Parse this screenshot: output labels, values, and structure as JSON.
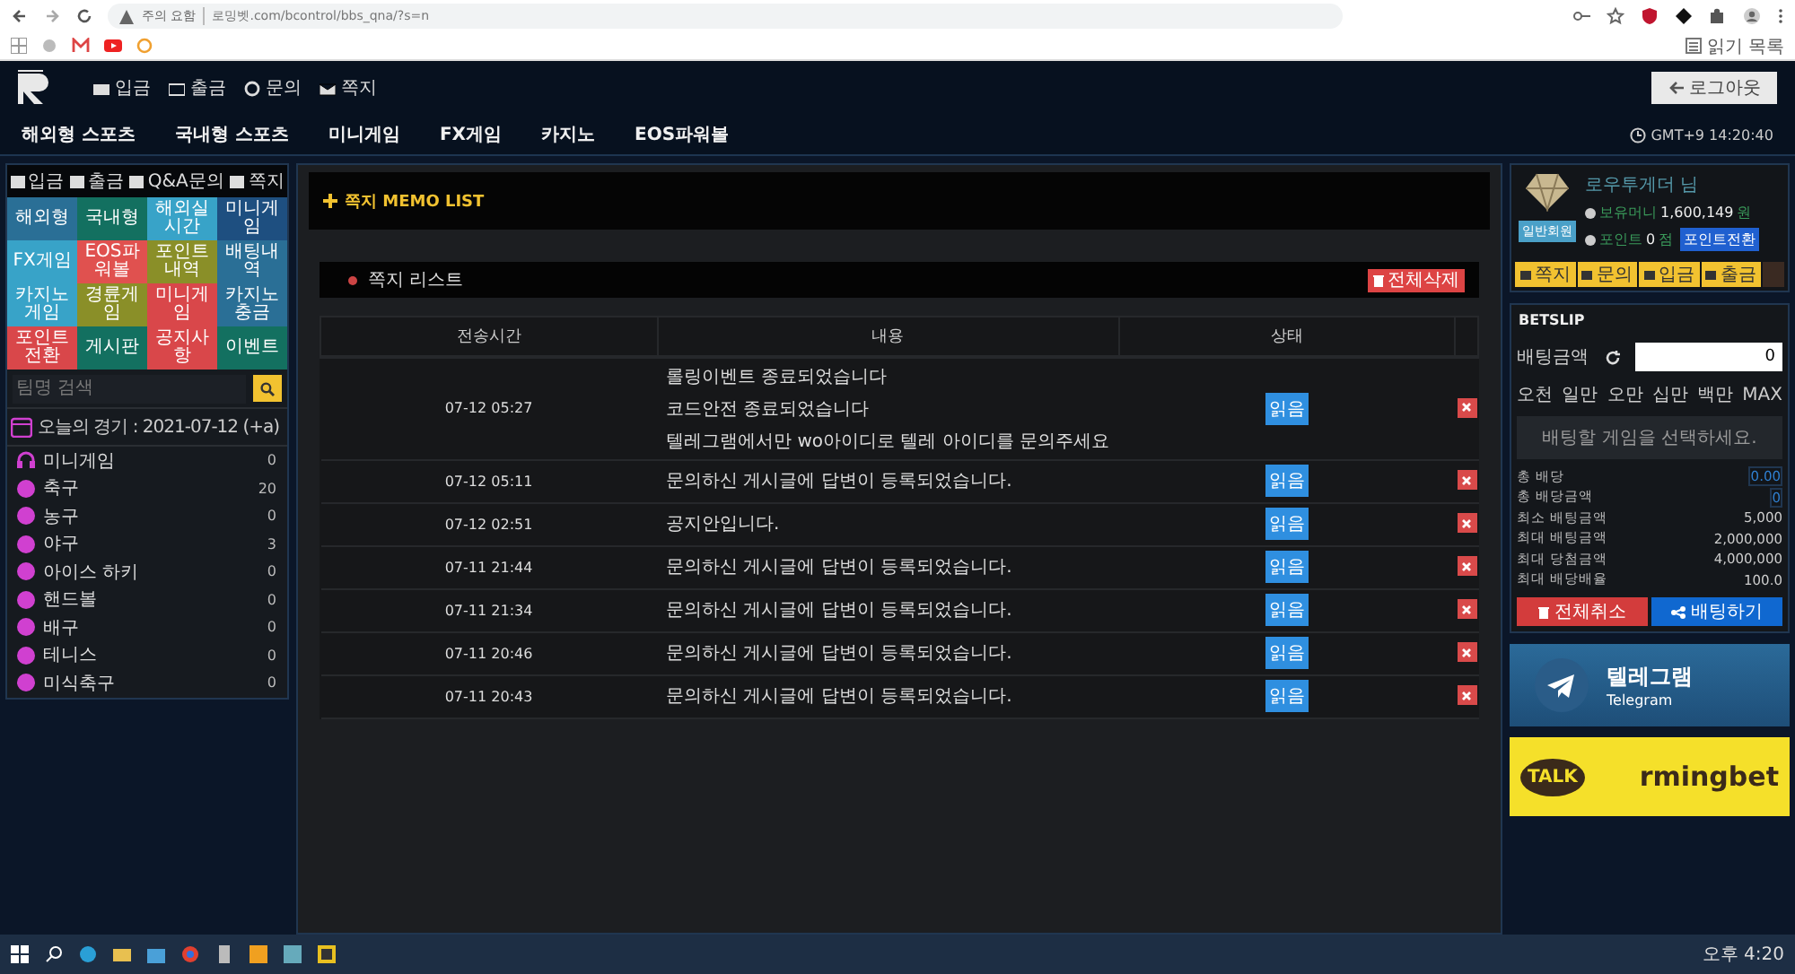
{
  "browser": {
    "warning": "주의 요함",
    "url": "로밍벳.com/bcontrol/bbs_qna/?s=n",
    "reading_list": "읽기 목록"
  },
  "header": {
    "top_links": [
      "입금",
      "출금",
      "문의",
      "쪽지"
    ],
    "nav": [
      "해외형 스포츠",
      "국내형 스포츠",
      "미니게임",
      "FX게임",
      "카지노",
      "EOS파워볼"
    ],
    "logout_button": "로그아웃",
    "clock": "GMT+9 14:20:40"
  },
  "sidebar": {
    "tabs": [
      "입금",
      "출금",
      "Q&A문의",
      "쪽지"
    ],
    "menu_buttons": [
      {
        "label": "해외형",
        "color": "#2a6f96"
      },
      {
        "label": "국내형",
        "color": "#137060"
      },
      {
        "label": "해외실시간",
        "color": "#38a3c8"
      },
      {
        "label": "미니게임",
        "color": "#1e4f80"
      },
      {
        "label": "FX게임",
        "color": "#38a3c8"
      },
      {
        "label": "EOS파워볼",
        "color": "#e0514f"
      },
      {
        "label": "포인트내역",
        "color": "#8a8f28"
      },
      {
        "label": "배팅내역",
        "color": "#2a6f96"
      },
      {
        "label": "카지노게임",
        "color": "#38a3c8"
      },
      {
        "label": "경륜게임",
        "color": "#8a8f28"
      },
      {
        "label": "미니게임",
        "color": "#d9474a"
      },
      {
        "label": "카지노충금",
        "color": "#2a6f96"
      },
      {
        "label": "포인트전환",
        "color": "#d9474a"
      },
      {
        "label": "게시판",
        "color": "#137060"
      },
      {
        "label": "공지사항",
        "color": "#d9474a"
      },
      {
        "label": "이벤트",
        "color": "#137060"
      }
    ],
    "search": {
      "placeholder": "팀명 검색"
    },
    "today": "오늘의 경기 : 2021-07-12 (+a)",
    "sports": [
      {
        "name": "미니게임",
        "count": "0"
      },
      {
        "name": "축구",
        "count": "20"
      },
      {
        "name": "농구",
        "count": "0"
      },
      {
        "name": "야구",
        "count": "3"
      },
      {
        "name": "아이스 하키",
        "count": "0"
      },
      {
        "name": "핸드볼",
        "count": "0"
      },
      {
        "name": "배구",
        "count": "0"
      },
      {
        "name": "테니스",
        "count": "0"
      },
      {
        "name": "미식축구",
        "count": "0"
      }
    ]
  },
  "memo": {
    "title": "쪽지 MEMO LIST",
    "list_title": "쪽지 리스트",
    "delete_all_button": "전체삭제",
    "columns": [
      "전송시간",
      "내용",
      "상태"
    ],
    "rows": [
      {
        "time": "07-12 05:27",
        "lines": [
          "롤링이벤트 종료되었습니다",
          "코드안전 종료되었습니다",
          "텔레그램에서만 wo아이디로 텔레 아이디를 문의주세요"
        ],
        "status": "읽음"
      },
      {
        "time": "07-12 05:11",
        "lines": [
          "문의하신 게시글에 답변이 등록되었습니다."
        ],
        "status": "읽음"
      },
      {
        "time": "07-12 02:51",
        "lines": [
          "공지안입니다."
        ],
        "status": "읽음"
      },
      {
        "time": "07-11 21:44",
        "lines": [
          "문의하신 게시글에 답변이 등록되었습니다."
        ],
        "status": "읽음"
      },
      {
        "time": "07-11 21:34",
        "lines": [
          "문의하신 게시글에 답변이 등록되었습니다."
        ],
        "status": "읽음"
      },
      {
        "time": "07-11 20:46",
        "lines": [
          "문의하신 게시글에 답변이 등록되었습니다."
        ],
        "status": "읽음"
      },
      {
        "time": "07-11 20:43",
        "lines": [
          "문의하신 게시글에 답변이 등록되었습니다."
        ],
        "status": "읽음"
      }
    ]
  },
  "account": {
    "level": "일반회원",
    "name": "로우투게더 님",
    "money_label": "보유머니",
    "money": "1,600,149",
    "money_unit": "원",
    "point_label": "포인트",
    "point": "0",
    "point_unit": "점",
    "convert_button": "포인트전환",
    "actions": [
      "쪽지",
      "문의",
      "입금",
      "출금"
    ]
  },
  "betslip": {
    "title": "BETSLIP",
    "amount_label": "배팅금액",
    "amount_value": "0",
    "quick": [
      "오천",
      "일만",
      "오만",
      "십만",
      "백만",
      "MAX"
    ],
    "message": "배팅할 게임을 선택하세요.",
    "summary": [
      {
        "label": "총 배당",
        "value": "0.00",
        "kind": "accent"
      },
      {
        "label": "총 배당금액",
        "value": "0",
        "kind": "accent"
      },
      {
        "label": "최소 배팅금액",
        "value": "5,000",
        "kind": "plain"
      },
      {
        "label": "최대 배팅금액",
        "value": "2,000,000",
        "kind": "plain"
      },
      {
        "label": "최대 당첨금액",
        "value": "4,000,000",
        "kind": "plain"
      },
      {
        "label": "최대 배당배율",
        "value": "100.0",
        "kind": "plain"
      }
    ],
    "cancel_button": "전체취소",
    "bet_button": "배팅하기"
  },
  "banners": {
    "telegram_title": "텔레그램",
    "telegram_subtitle": "Telegram",
    "kakao_badge": "TALK",
    "kakao_name": "rmingbet"
  },
  "taskbar": {
    "clock": "오후 4:20"
  }
}
